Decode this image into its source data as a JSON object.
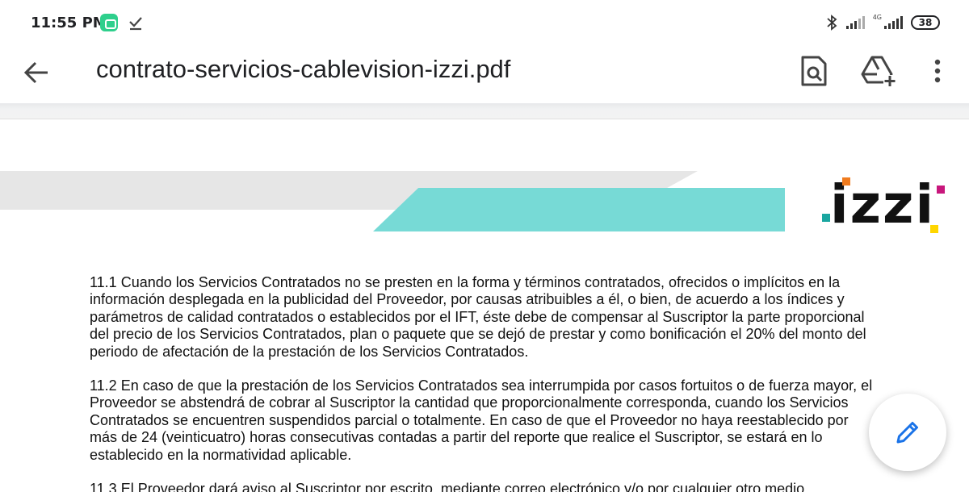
{
  "status_bar": {
    "time": "11:55 PM",
    "network_label": "4G",
    "battery": "38",
    "icons": [
      "app-notification-icon",
      "download-done-icon",
      "bluetooth-icon",
      "signal-icon",
      "signal-4g-icon",
      "battery-icon"
    ]
  },
  "app_bar": {
    "title": "contrato-servicios-cablevision-izzi.pdf",
    "icons": [
      "back-arrow-icon",
      "find-in-page-icon",
      "add-to-drive-icon",
      "more-vert-icon"
    ]
  },
  "document": {
    "logo_text": "izzi",
    "colors": {
      "banner_gray": "#e6e6e6",
      "banner_teal": "#77dad6",
      "logo_orange": "#f07b1e",
      "logo_teal": "#1aa6a0",
      "logo_magenta": "#c8177c",
      "logo_yellow": "#ffd600"
    },
    "paragraphs": [
      "11.1 Cuando los Servicios Contratados no se presten en la forma y términos contratados, ofrecidos o implícitos en la información desplegada en la publicidad del Proveedor, por causas atribuibles a él, o bien, de acuerdo a los índices y parámetros de calidad contratados o establecidos por el IFT, éste debe de compensar al Suscriptor la parte proporcional del precio de los Servicios Contratados, plan o paquete que se dejó de prestar y como bonificación el 20% del monto del periodo de afectación de la prestación de los Servicios Contratados.",
      "11.2 En caso de que la prestación de los Servicios Contratados sea interrumpida por casos fortuitos o de fuerza mayor, el Proveedor se abstendrá de cobrar al Suscriptor la cantidad que proporcionalmente corresponda, cuando los Servicios Contratados se encuentren suspendidos parcial o totalmente. En caso de que el Proveedor no haya reestablecido por más de 24 (veinticuatro) horas consecutivas contadas a partir del reporte que realice el Suscriptor, se estará en lo establecido en la normatividad aplicable.",
      "11.3 El Proveedor dará aviso al Suscriptor por escrito, mediante correo electrónico y/o por cualquier otro medio"
    ]
  },
  "fab": {
    "icon": "edit-pencil-icon",
    "color": "#1a73e8"
  }
}
